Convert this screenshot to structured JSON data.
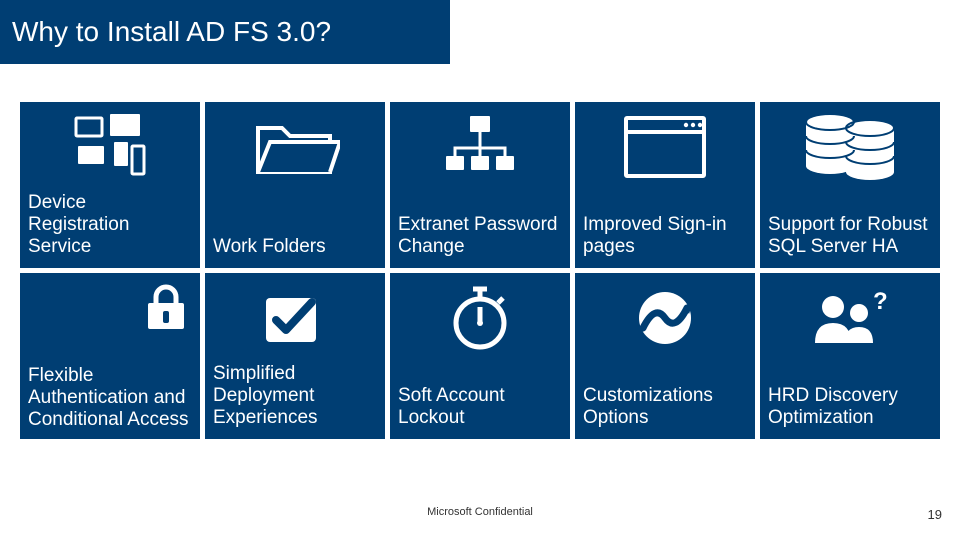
{
  "title": "Why to Install AD FS 3.0?",
  "footer": "Microsoft Confidential",
  "page_number": "19",
  "tiles": {
    "device_reg": "Device Registration Service",
    "work_folders": "Work Folders",
    "extranet_pw": "Extranet Password Change",
    "signin": "Improved Sign-in pages",
    "sql_ha": "Support for Robust SQL Server HA",
    "flex_auth": "Flexible Authentication and Conditional Access",
    "deploy": "Simplified Deployment Experiences",
    "lockout": "Soft Account Lockout",
    "custom": "Customizations Options",
    "hrd": "HRD Discovery Optimization"
  },
  "colors": {
    "tile_bg": "#003e73",
    "icon_fg": "#ffffff"
  }
}
